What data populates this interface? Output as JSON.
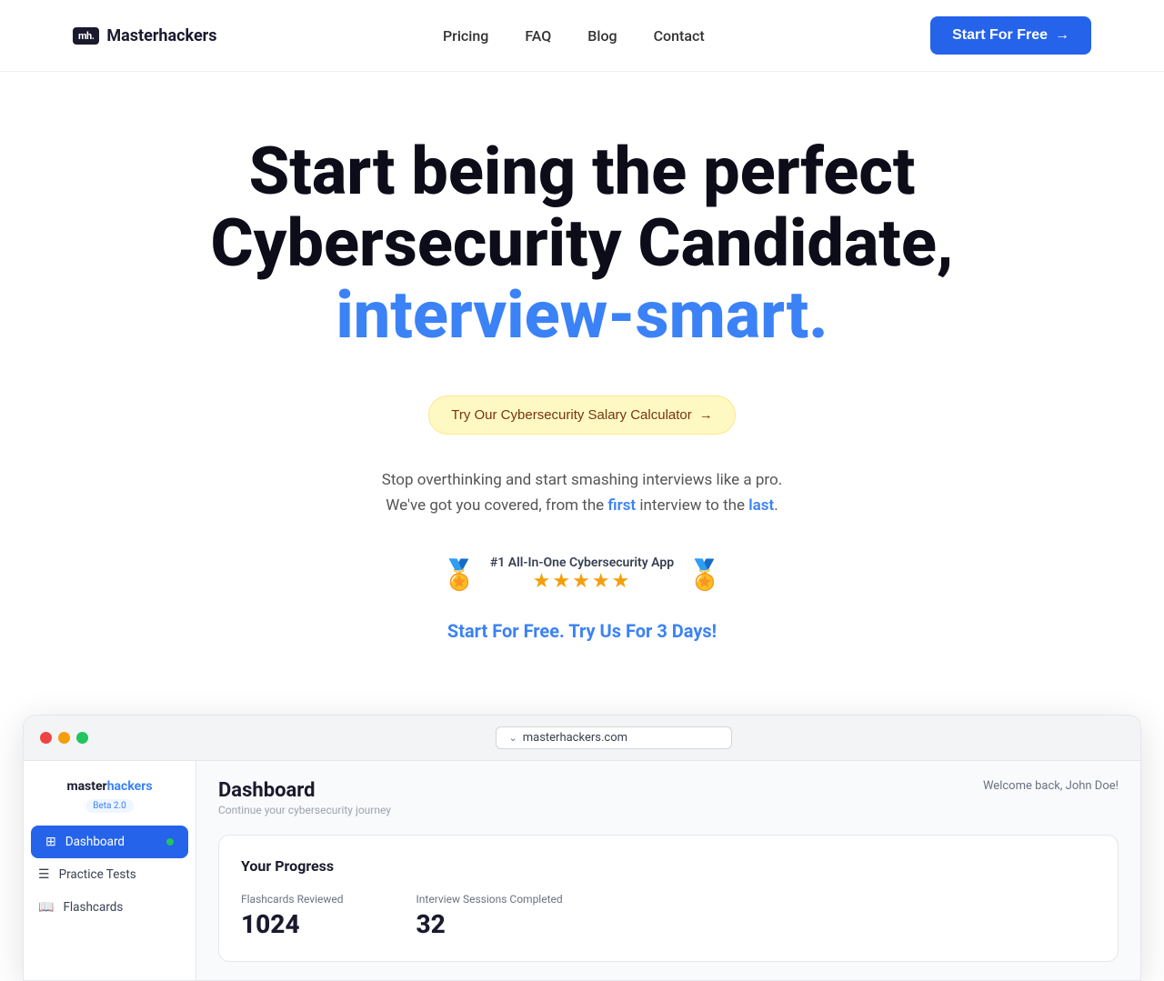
{
  "nav": {
    "logo_badge": "mh.",
    "logo_name": "Masterhackers",
    "links": [
      {
        "label": "Pricing",
        "id": "pricing"
      },
      {
        "label": "FAQ",
        "id": "faq"
      },
      {
        "label": "Blog",
        "id": "blog"
      },
      {
        "label": "Contact",
        "id": "contact"
      }
    ],
    "cta_label": "Start For Free",
    "cta_arrow": "→"
  },
  "hero": {
    "title_line1": "Start being the perfect",
    "title_line2": "Cybersecurity Candidate,",
    "title_line3": "interview-smart.",
    "calc_btn": "Try Our Cybersecurity Salary Calculator",
    "calc_arrow": "→",
    "subtitle_line1": "Stop overthinking and start smashing interviews like a pro.",
    "subtitle_line2_before": "We've got you covered, from the ",
    "subtitle_first": "first",
    "subtitle_middle": " interview to the ",
    "subtitle_last": "last",
    "subtitle_end": ".",
    "award_text": "#1 All-In-One Cybersecurity App",
    "stars": "★★★★★",
    "free_text": "Start For Free.",
    "free_cta": "Try Us For 3 Days!"
  },
  "browser": {
    "url": "masterhackers.com",
    "dots": {
      "red": "red",
      "yellow": "yellow",
      "green": "green"
    }
  },
  "app": {
    "sidebar": {
      "logo_master": "master",
      "logo_hackers": "hackers",
      "beta": "Beta 2.0",
      "items": [
        {
          "label": "Dashboard",
          "icon": "⊞",
          "active": true,
          "dot": true
        },
        {
          "label": "Practice Tests",
          "icon": "☰",
          "active": false
        },
        {
          "label": "Flashcards",
          "icon": "📖",
          "active": false
        }
      ]
    },
    "main": {
      "title": "Dashboard",
      "subtitle": "Continue your cybersecurity journey",
      "welcome": "Welcome back, John Doe!",
      "progress_title": "Your Progress",
      "stats": [
        {
          "label": "Flashcards Reviewed",
          "value": "1024"
        },
        {
          "label": "Interview Sessions Completed",
          "value": "32"
        }
      ]
    }
  }
}
